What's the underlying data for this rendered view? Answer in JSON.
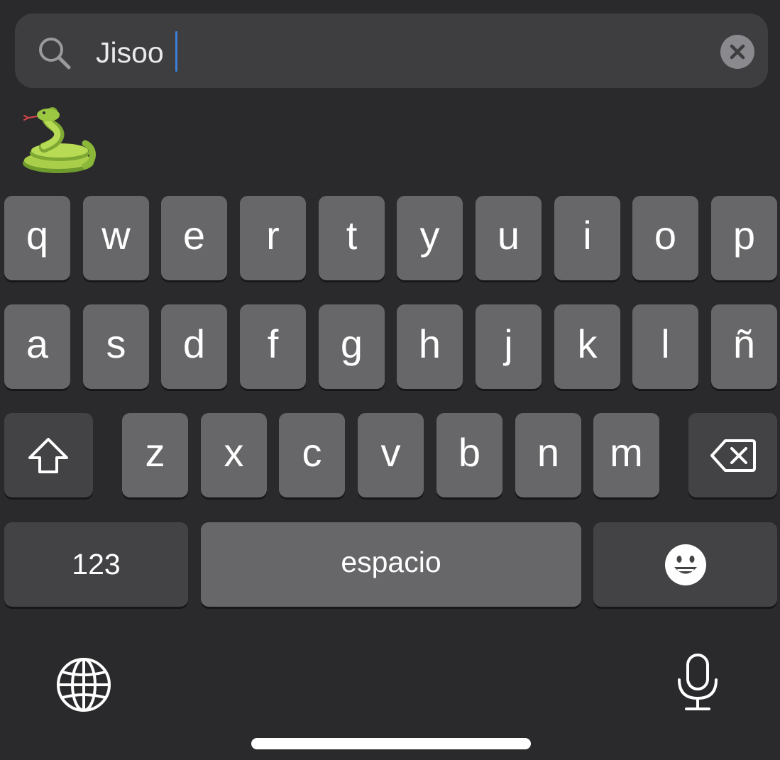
{
  "search": {
    "value": "Jisoo",
    "icon": "search-icon",
    "clear_icon": "close-icon"
  },
  "results": {
    "emoji_name": "snake"
  },
  "keyboard": {
    "row1": [
      "q",
      "w",
      "e",
      "r",
      "t",
      "y",
      "u",
      "i",
      "o",
      "p"
    ],
    "row2": [
      "a",
      "s",
      "d",
      "f",
      "g",
      "h",
      "j",
      "k",
      "l",
      "ñ"
    ],
    "row3": [
      "z",
      "x",
      "c",
      "v",
      "b",
      "n",
      "m"
    ],
    "shift_icon": "shift-arrow-icon",
    "backspace_icon": "backspace-icon",
    "numbers_label": "123",
    "space_label": "espacio",
    "emoji_icon": "smiley-icon",
    "globe_icon": "globe-icon",
    "mic_icon": "microphone-icon"
  },
  "colors": {
    "background": "#2a2a2c",
    "key_light": "#676769",
    "key_dark": "#434345",
    "cursor": "#3d7fd6"
  }
}
